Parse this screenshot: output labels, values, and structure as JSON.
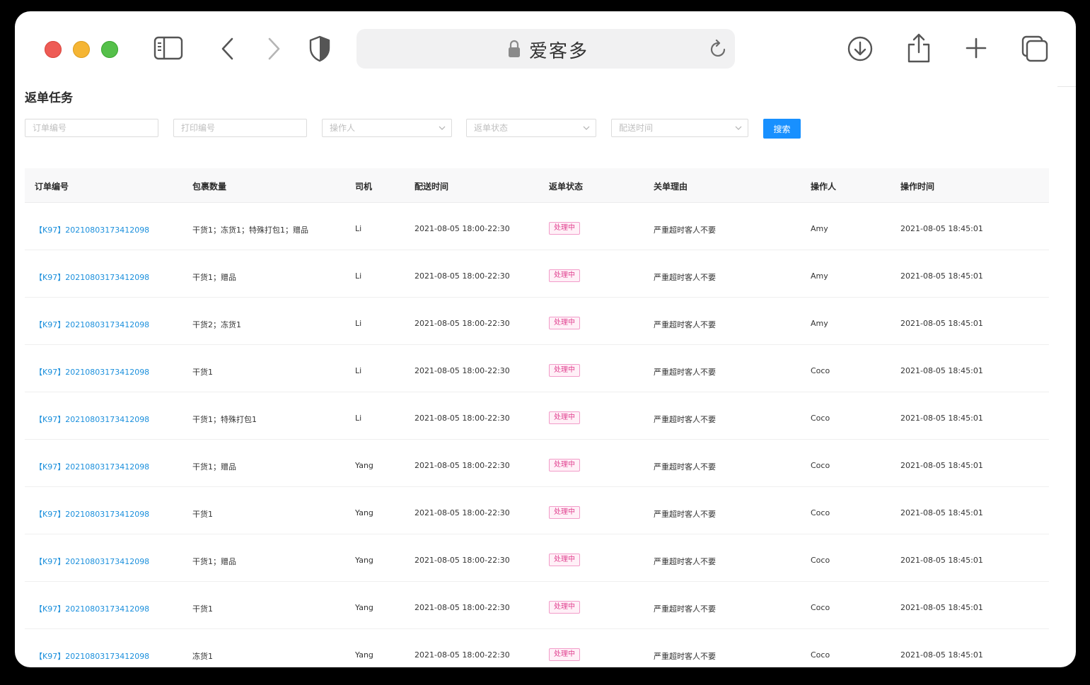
{
  "browser": {
    "address_title": "爱客多"
  },
  "page": {
    "title": "返单任务"
  },
  "filters": {
    "order_no_placeholder": "订单编号",
    "print_no_placeholder": "打印编号",
    "operator_placeholder": "操作人",
    "status_placeholder": "返单状态",
    "delivery_time_placeholder": "配送时间",
    "search_label": "搜索"
  },
  "table": {
    "columns": [
      "订单编号",
      "包裹数量",
      "司机",
      "配送时间",
      "返单状态",
      "关单理由",
      "操作人",
      "操作时间"
    ],
    "rows": [
      {
        "order": "【K97】20210803173412098",
        "packages": "干货1；冻货1；特殊打包1；赠品",
        "driver": "Li",
        "delivery": "2021-08-05 18:00-22:30",
        "status": "处理中",
        "reason": "严重超时客人不要",
        "operator": "Amy",
        "op_time": "2021-08-05 18:45:01"
      },
      {
        "order": "【K97】20210803173412098",
        "packages": "干货1；赠品",
        "driver": "Li",
        "delivery": "2021-08-05 18:00-22:30",
        "status": "处理中",
        "reason": "严重超时客人不要",
        "operator": "Amy",
        "op_time": "2021-08-05 18:45:01"
      },
      {
        "order": "【K97】20210803173412098",
        "packages": "干货2；冻货1",
        "driver": "Li",
        "delivery": "2021-08-05 18:00-22:30",
        "status": "处理中",
        "reason": "严重超时客人不要",
        "operator": "Amy",
        "op_time": "2021-08-05 18:45:01"
      },
      {
        "order": "【K97】20210803173412098",
        "packages": "干货1",
        "driver": "Li",
        "delivery": "2021-08-05 18:00-22:30",
        "status": "处理中",
        "reason": "严重超时客人不要",
        "operator": "Coco",
        "op_time": "2021-08-05 18:45:01"
      },
      {
        "order": "【K97】20210803173412098",
        "packages": "干货1；特殊打包1",
        "driver": "Li",
        "delivery": "2021-08-05 18:00-22:30",
        "status": "处理中",
        "reason": "严重超时客人不要",
        "operator": "Coco",
        "op_time": "2021-08-05 18:45:01"
      },
      {
        "order": "【K97】20210803173412098",
        "packages": "干货1；赠品",
        "driver": "Yang",
        "delivery": "2021-08-05 18:00-22:30",
        "status": "处理中",
        "reason": "严重超时客人不要",
        "operator": "Coco",
        "op_time": "2021-08-05 18:45:01"
      },
      {
        "order": "【K97】20210803173412098",
        "packages": "干货1",
        "driver": "Yang",
        "delivery": "2021-08-05 18:00-22:30",
        "status": "处理中",
        "reason": "严重超时客人不要",
        "operator": "Coco",
        "op_time": "2021-08-05 18:45:01"
      },
      {
        "order": "【K97】20210803173412098",
        "packages": "干货1；赠品",
        "driver": "Yang",
        "delivery": "2021-08-05 18:00-22:30",
        "status": "处理中",
        "reason": "严重超时客人不要",
        "operator": "Coco",
        "op_time": "2021-08-05 18:45:01"
      },
      {
        "order": "【K97】20210803173412098",
        "packages": "干货1",
        "driver": "Yang",
        "delivery": "2021-08-05 18:00-22:30",
        "status": "处理中",
        "reason": "严重超时客人不要",
        "operator": "Coco",
        "op_time": "2021-08-05 18:45:01"
      },
      {
        "order": "【K97】20210803173412098",
        "packages": "冻货1",
        "driver": "Yang",
        "delivery": "2021-08-05 18:00-22:30",
        "status": "处理中",
        "reason": "严重超时客人不要",
        "operator": "Coco",
        "op_time": "2021-08-05 18:45:01"
      }
    ]
  },
  "colors": {
    "link": "#1a8fdc",
    "primary_button": "#1890ff",
    "status_text": "#e0408f",
    "status_border": "#f29cc9"
  },
  "icons": [
    "sidebar-icon",
    "back-icon",
    "forward-icon",
    "shield-icon",
    "lock-icon",
    "reload-icon",
    "download-icon",
    "share-icon",
    "new-tab-icon",
    "tabs-overview-icon",
    "chevron-down-icon"
  ]
}
